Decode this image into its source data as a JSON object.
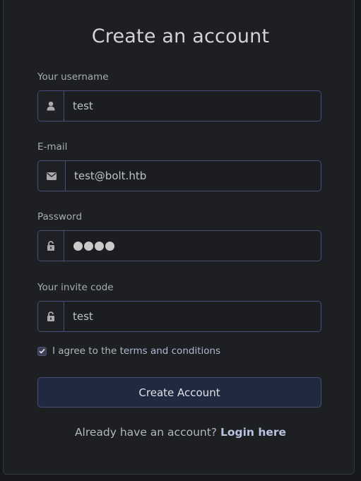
{
  "form": {
    "title": "Create an account",
    "username": {
      "label": "Your username",
      "value": "test",
      "icon": "user-icon"
    },
    "email": {
      "label": "E-mail",
      "value": "test@bolt.htb",
      "icon": "envelope-icon"
    },
    "password": {
      "label": "Password",
      "masked_length": 4,
      "icon": "unlock-icon"
    },
    "invite": {
      "label": "Your invite code",
      "value": "test",
      "icon": "unlock-icon"
    },
    "agree": {
      "prefix": "I agree to the ",
      "link_text": "terms and conditions",
      "checked": true
    },
    "submit_label": "Create Account",
    "footer": {
      "text": "Already have an account? ",
      "link_text": "Login here"
    }
  },
  "colors": {
    "background": "#1d1f23",
    "border_accent": "#4a4c7a",
    "button": "#1f2a40",
    "link": "#aeb8d4"
  }
}
